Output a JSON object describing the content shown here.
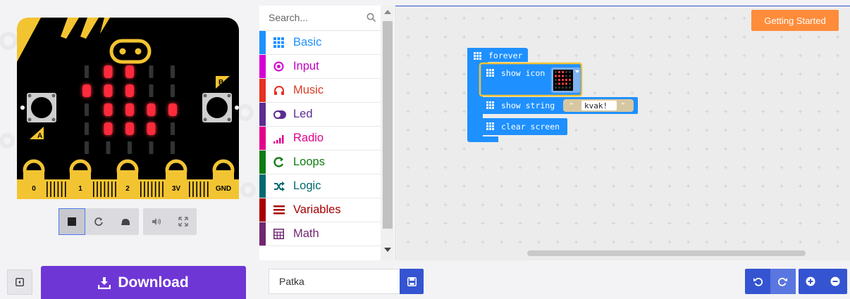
{
  "simulator": {
    "pin_labels": [
      "0",
      "1",
      "2",
      "3V",
      "GND"
    ],
    "button_a": "A",
    "button_b": "B",
    "led_grid": [
      [
        0,
        1,
        1,
        0,
        0
      ],
      [
        1,
        1,
        1,
        0,
        0
      ],
      [
        0,
        1,
        1,
        1,
        1
      ],
      [
        0,
        1,
        1,
        1,
        0
      ],
      [
        0,
        0,
        0,
        0,
        0
      ]
    ],
    "controls": [
      "stop",
      "restart",
      "slow-mo",
      "mute",
      "fullscreen"
    ]
  },
  "toolbox": {
    "search_placeholder": "Search...",
    "categories": [
      {
        "label": "Basic",
        "color": "#1e90ff",
        "text_color": "#1e90ff",
        "icon": "grid-icon"
      },
      {
        "label": "Input",
        "color": "#d400d4",
        "text_color": "#c000c0",
        "icon": "target-icon"
      },
      {
        "label": "Music",
        "color": "#e63022",
        "text_color": "#d93a26",
        "icon": "headphones-icon"
      },
      {
        "label": "Led",
        "color": "#5c2d91",
        "text_color": "#5c2d91",
        "icon": "toggle-icon"
      },
      {
        "label": "Radio",
        "color": "#e3008c",
        "text_color": "#e3008c",
        "icon": "signal-icon"
      },
      {
        "label": "Loops",
        "color": "#107c10",
        "text_color": "#107c10",
        "icon": "loop-icon"
      },
      {
        "label": "Logic",
        "color": "#006970",
        "text_color": "#006970",
        "icon": "shuffle-icon"
      },
      {
        "label": "Variables",
        "color": "#a80000",
        "text_color": "#a80000",
        "icon": "lines-icon"
      },
      {
        "label": "Math",
        "color": "#712672",
        "text_color": "#712672",
        "icon": "calculator-icon"
      }
    ]
  },
  "workspace": {
    "getting_started": "Getting Started",
    "blocks": {
      "forever": "forever",
      "show_icon": "show icon",
      "show_string": "show string",
      "string_value": "kvak!",
      "clear_screen": "clear screen"
    },
    "block_color": "#1e90ff"
  },
  "bottom": {
    "download_label": "Download",
    "project_name": "Patka"
  }
}
